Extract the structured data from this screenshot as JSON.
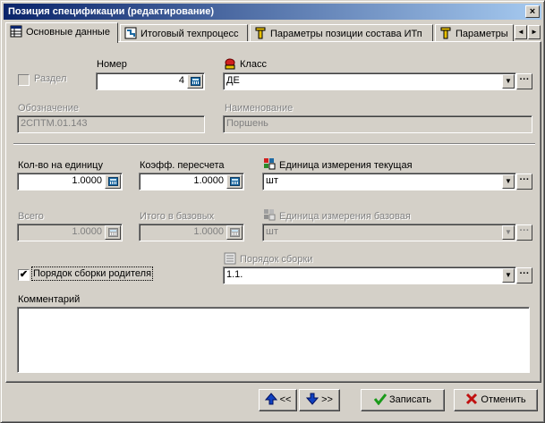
{
  "window": {
    "title": "Позиция спецификации (редактирование)",
    "close_glyph": "×"
  },
  "tabs": [
    {
      "label": "Основные данные",
      "icon": "table-icon",
      "active": true
    },
    {
      "label": "Итоговый техпроцесс",
      "icon": "process-icon",
      "active": false
    },
    {
      "label": "Параметры позиции состава ИТп",
      "icon": "parameters-icon",
      "active": false
    },
    {
      "label": "Параметры",
      "icon": "parameters-icon",
      "active": false
    }
  ],
  "tab_scroll": {
    "left": "◄",
    "right": "►"
  },
  "form": {
    "section_label": "Раздел",
    "section_checked": false,
    "number_label": "Номер",
    "number_value": "4",
    "class_label": "Класс",
    "class_value": "ДЕ",
    "designation_label": "Обозначение",
    "designation_value": "2СПТМ.01.143",
    "name_label": "Наименование",
    "name_value": "Поршень",
    "qty_per_unit_label": "Кол-во на единицу",
    "qty_per_unit_value": "1.0000",
    "conv_factor_label": "Коэфф. пересчета",
    "conv_factor_value": "1.0000",
    "unit_current_label": "Единица измерения текущая",
    "unit_current_value": "шт",
    "total_label": "Всего",
    "total_value": "1.0000",
    "total_base_label": "Итого в базовых",
    "total_base_value": "1.0000",
    "unit_base_label": "Единица измерения базовая",
    "unit_base_value": "шт",
    "parent_order_label": "Порядок сборки родителя",
    "parent_order_checked": true,
    "assembly_order_label": "Порядок сборки",
    "assembly_order_value": "1.1.",
    "comment_label": "Комментарий",
    "comment_value": ""
  },
  "footer": {
    "prev_label": "<<",
    "next_label": ">>",
    "save_label": "Записать",
    "cancel_label": "Отменить"
  },
  "glyphs": {
    "dropdown": "▼",
    "ellipsis": "···",
    "check": "✔"
  },
  "colors": {
    "title_start": "#0a246a",
    "title_end": "#a6caf0",
    "face": "#d4d0c8"
  }
}
